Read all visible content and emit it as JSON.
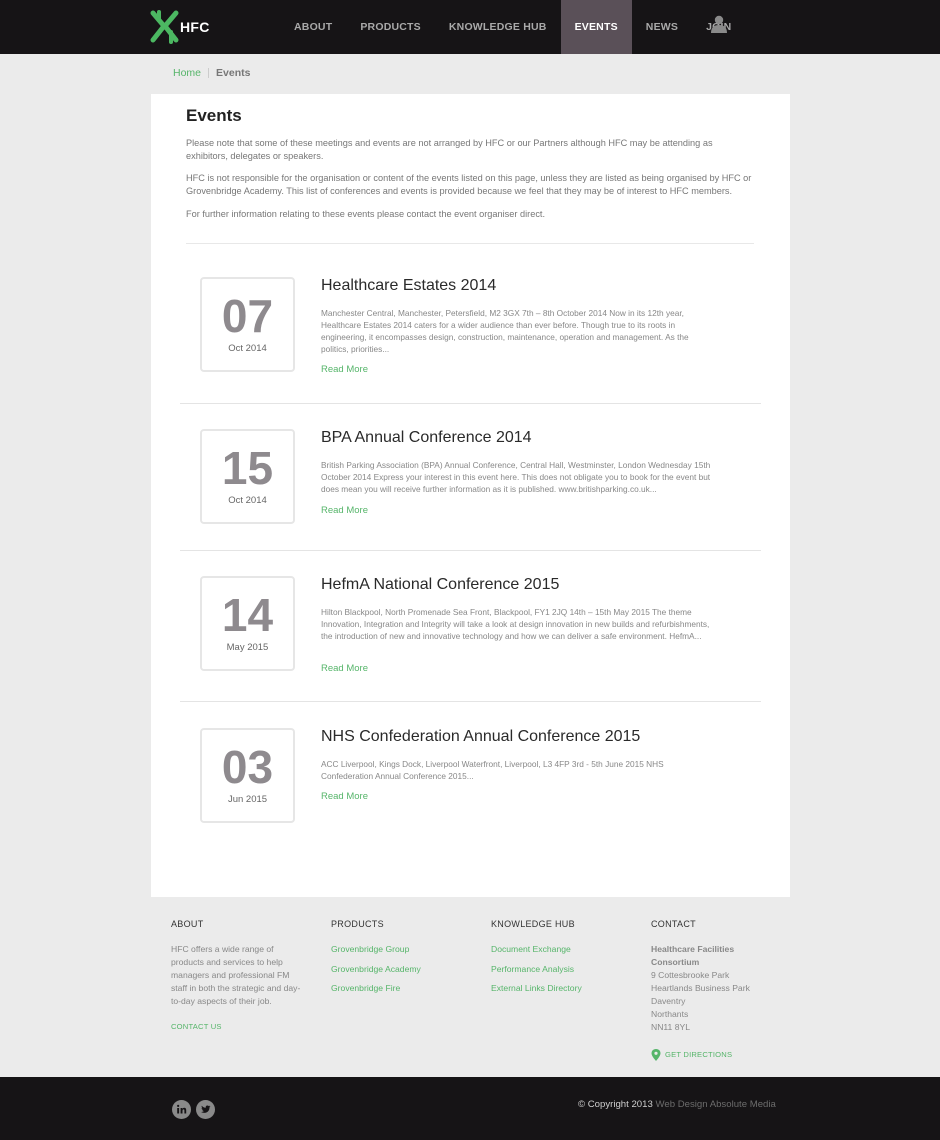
{
  "brand": {
    "logo_text": "HFC",
    "accent": "#56b56a",
    "nav_bg": "#161416",
    "active_bg": "#5a5058"
  },
  "nav": {
    "items": [
      {
        "label": "ABOUT"
      },
      {
        "label": "PRODUCTS"
      },
      {
        "label": "KNOWLEDGE HUB"
      },
      {
        "label": "EVENTS",
        "active": true
      },
      {
        "label": "NEWS"
      },
      {
        "label": "JOIN"
      }
    ],
    "user_icon": "user-icon"
  },
  "breadcrumb": {
    "home": "Home",
    "current": "Events"
  },
  "page": {
    "title": "Events",
    "intro": [
      "Please note that some of these meetings and events are not arranged by HFC or our Partners although HFC may be attending as exhibitors, delegates or speakers.",
      "HFC is not responsible for the organisation or content of the events listed on this page, unless they are listed as being organised by HFC or Grovenbridge Academy. This list of conferences and events is provided because we feel that they may be of interest to HFC members.",
      "For further information relating to these events please contact the event organiser direct."
    ]
  },
  "events": [
    {
      "day": "07",
      "month": "Oct 2014",
      "title": "Healthcare Estates 2014",
      "description": "Manchester Central, Manchester, Petersfield, M2 3GX 7th – 8th October 2014 Now in its 12th year, Healthcare Estates 2014 caters for a wider audience than ever before. Though true to its roots in engineering, it encompasses design, construction, maintenance, operation and management. As the politics, priorities...",
      "more": "Read More"
    },
    {
      "day": "15",
      "month": "Oct 2014",
      "title": "BPA Annual Conference 2014",
      "description": "British Parking Association (BPA) Annual Conference, Central Hall, Westminster, London Wednesday 15th October 2014 Express your interest in this event here. This does not obligate you to book for the event but does mean you will receive further information as it is published. www.britishparking.co.uk...",
      "more": "Read More"
    },
    {
      "day": "14",
      "month": "May 2015",
      "title": "HefmA National Conference 2015",
      "description": "Hilton Blackpool, North Promenade Sea Front, Blackpool, FY1 2JQ 14th – 15th May 2015 The theme Innovation, Integration and Integrity will take a look at design innovation in new builds and refurbishments, the introduction of new and innovative technology and how we can deliver a safe environment. HefmA...",
      "more": "Read More"
    },
    {
      "day": "03",
      "month": "Jun 2015",
      "title": "NHS Confederation Annual Conference 2015",
      "description": "ACC Liverpool, Kings Dock, Liverpool Waterfront, Liverpool, L3 4FP 3rd - 5th June 2015 NHS Confederation Annual Conference 2015...",
      "more": "Read More"
    }
  ],
  "footer": {
    "about": {
      "heading": "ABOUT",
      "text": "HFC offers a wide range of products and services to help managers and professional FM staff in both the strategic and day-to-day aspects of their job.",
      "contact_link": "CONTACT US"
    },
    "products": {
      "heading": "PRODUCTS",
      "links": [
        "Grovenbridge Group",
        "Grovenbridge Academy",
        "Grovenbridge Fire"
      ]
    },
    "knowledge": {
      "heading": "KNOWLEDGE HUB",
      "links": [
        "Document Exchange",
        "Performance Analysis",
        "External Links Directory"
      ]
    },
    "contact": {
      "heading": "CONTACT",
      "name": "Healthcare Facilities Consortium",
      "address": [
        "9 Cottesbrooke Park",
        "Heartlands Business Park",
        "Daventry",
        "Northants",
        "NN11 8YL"
      ],
      "directions": "GET DIRECTIONS",
      "pin_icon": "map-pin-icon"
    }
  },
  "bottom": {
    "social": [
      "linkedin-icon",
      "twitter-icon"
    ],
    "copyright": "© Copyright 2013",
    "credit": "Web Design Absolute Media"
  }
}
